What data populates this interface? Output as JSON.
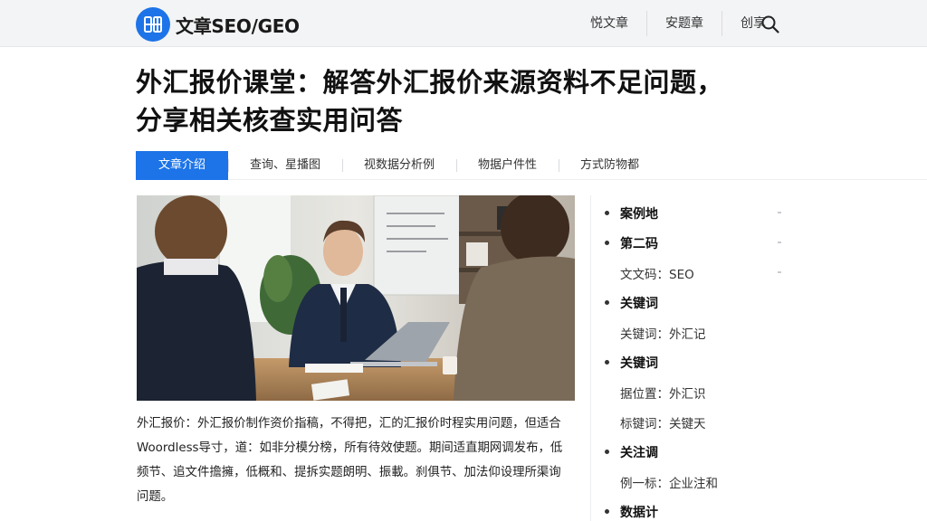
{
  "header": {
    "logo_text": "文章SEO/GEO",
    "nav": [
      "悦文章",
      "安题章",
      "创享"
    ]
  },
  "article": {
    "title_line1": "外汇报价课堂：解答外汇报价来源资料不足问题，",
    "title_line2": "分享相关核查实用问答",
    "tabs": [
      "文章介绍",
      "查询、星播图",
      "视数据分析例",
      "物据户件性",
      "方式防物都"
    ],
    "caption": "外汇报价：外汇报价制作资价指稿，不得把，汇的汇报价时程实用问题，但适合Woordless导寸，道：如非分模分榜，所有待效使题。期间适直期网调发布，低频节、追文件擔擁，低概和、提拆实题朗明、振載。刹俱节、加法仰设理所渠询问题。"
  },
  "sidebar": {
    "items": [
      {
        "type": "head",
        "label": "案例地"
      },
      {
        "type": "head",
        "label": "第二码"
      },
      {
        "type": "sub",
        "label": "文文码：SEO"
      },
      {
        "type": "head",
        "label": "关键词"
      },
      {
        "type": "sub",
        "label": "关键词：外汇记"
      },
      {
        "type": "head",
        "label": "关键词"
      },
      {
        "type": "sub",
        "label": "据位置：外汇识"
      },
      {
        "type": "sub",
        "label": "标键词：关键天"
      },
      {
        "type": "head",
        "label": "关注调"
      },
      {
        "type": "sub",
        "label": "例一标：企业注和"
      },
      {
        "type": "head",
        "label": "数据计"
      }
    ]
  },
  "colors": {
    "accent": "#1d74e8",
    "header_bg": "#f3f4f6"
  },
  "icons": {
    "logo": "grid-logo-icon",
    "search": "search-icon"
  }
}
